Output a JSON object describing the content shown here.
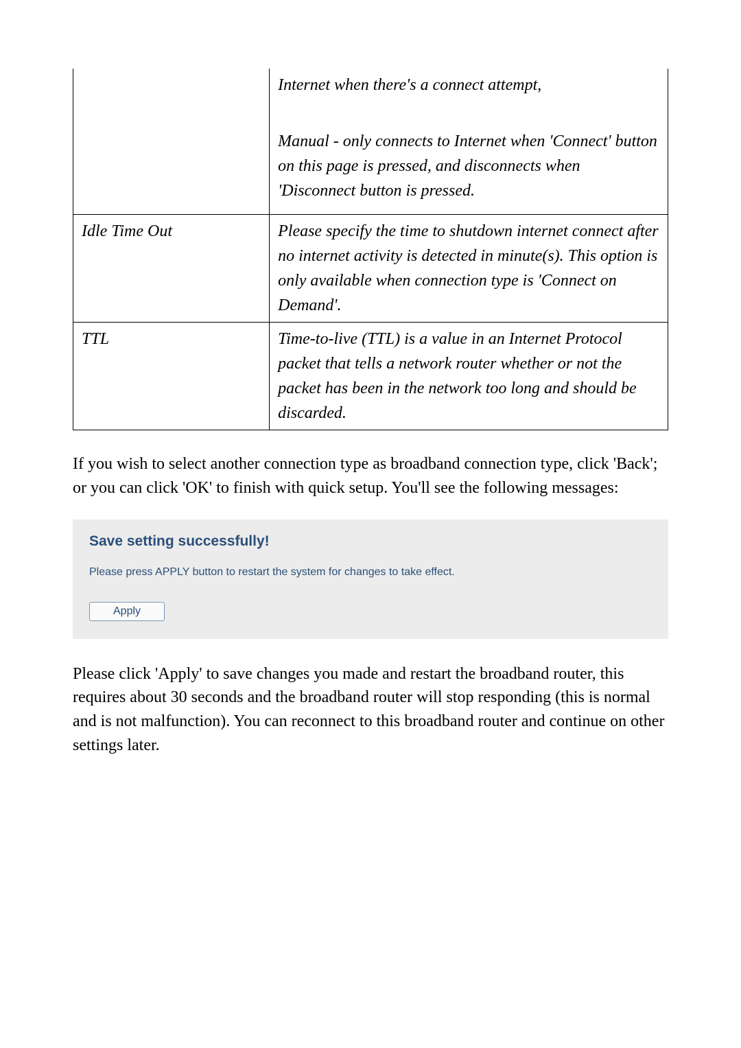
{
  "table": {
    "row0": {
      "left": "",
      "right_p1": "Internet when there's a connect attempt,",
      "right_p2": "Manual - only connects to Internet when 'Connect' button on this page is pressed, and disconnects when 'Disconnect button is pressed."
    },
    "row1": {
      "left": "Idle Time Out",
      "right": "Please specify the time to shutdown internet connect after no internet activity is detected in minute(s). This option is only available when connection type is 'Connect on Demand'."
    },
    "row2": {
      "left": "TTL",
      "right": "Time-to-live (TTL) is a value in an Internet Protocol packet that tells a network router whether or not the packet has been in the network too long and should be discarded."
    }
  },
  "para1": "If you wish to select another connection type as broadband connection type, click 'Back'; or you can click 'OK' to finish with quick setup. You'll see the following messages:",
  "savebox": {
    "title": "Save setting successfully!",
    "msg": "Please press APPLY button to restart the system for changes to take effect.",
    "button": "Apply"
  },
  "para2": "Please click 'Apply' to save changes you made and restart the broadband router, this requires about 30 seconds and the broadband router will stop responding (this is normal and is not malfunction). You can reconnect to this broadband router and continue on other settings later."
}
